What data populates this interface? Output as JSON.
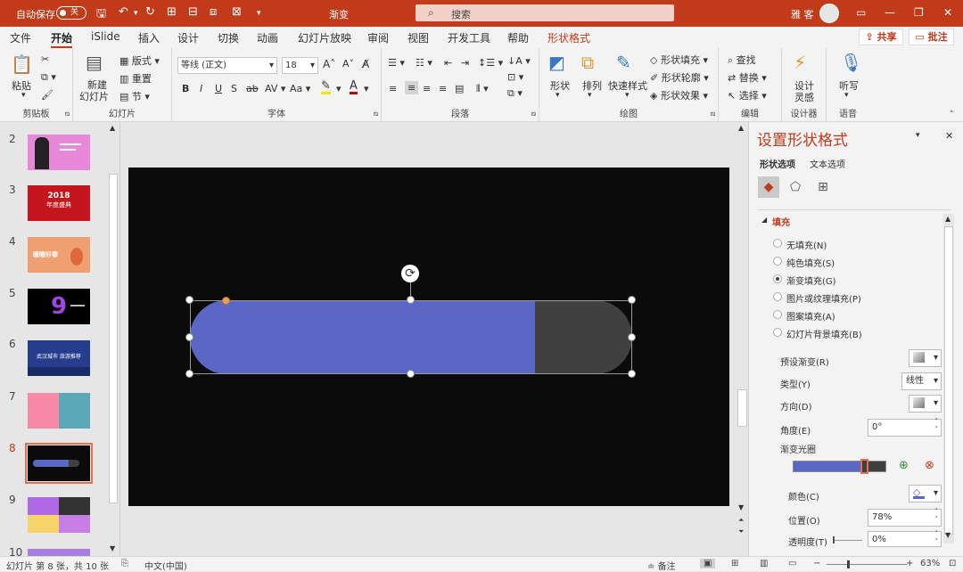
{
  "titlebar": {
    "autosave_label": "自动保存",
    "autosave_state": "关",
    "doc_title": "渐变",
    "search_label": "搜索",
    "user_name": "雅 客"
  },
  "tabs": [
    "文件",
    "开始",
    "iSlide",
    "插入",
    "设计",
    "切换",
    "动画",
    "幻灯片放映",
    "审阅",
    "视图",
    "开发工具",
    "帮助",
    "形状格式"
  ],
  "active_tab": "开始",
  "share_label": "共享",
  "comment_label": "批注",
  "ribbon": {
    "clipboard": {
      "paste": "粘贴",
      "label": "剪贴板"
    },
    "slides": {
      "new_slide_1": "新建",
      "new_slide_2": "幻灯片",
      "layout": "版式",
      "reset": "重置",
      "section": "节",
      "label": "幻灯片"
    },
    "font": {
      "name": "等线 (正文)",
      "size": "18",
      "label": "字体"
    },
    "paragraph": {
      "label": "段落"
    },
    "drawing": {
      "shapes": "形状",
      "arrange": "排列",
      "quick_styles": "快速样式",
      "shape_fill": "形状填充",
      "shape_outline": "形状轮廓",
      "shape_effects": "形状效果",
      "label": "绘图"
    },
    "editing": {
      "find": "查找",
      "replace": "替换",
      "select": "选择",
      "label": "编辑"
    },
    "designer": {
      "btn1": "设计",
      "btn2": "灵感",
      "label": "设计器"
    },
    "voice": {
      "btn": "听写",
      "label": "语音"
    }
  },
  "slide_numbers": [
    "2",
    "3",
    "4",
    "5",
    "6",
    "7",
    "8",
    "9",
    "10"
  ],
  "selected_slide": "8",
  "thumb_texts": {
    "t3": "2018",
    "t3b": "年度盛典",
    "t4": "暖暖好春",
    "t6": "武汉城市 旅游推荐"
  },
  "colors": {
    "accent": "#c13b1b",
    "bar_blue": "#5b67c4",
    "bar_gray": "#404040",
    "slide_bg": "#0b0b0b"
  },
  "pane": {
    "title": "设置形状格式",
    "tab_shape": "形状选项",
    "tab_text": "文本选项",
    "section": "填充",
    "fill_options": [
      "无填充(N)",
      "纯色填充(S)",
      "渐变填充(G)",
      "图片或纹理填充(P)",
      "图案填充(A)",
      "幻灯片背景填充(B)"
    ],
    "selected_fill": "渐变填充(G)",
    "preset_label": "预设渐变(R)",
    "type_label": "类型(Y)",
    "type_value": "线性",
    "direction_label": "方向(D)",
    "angle_label": "角度(E)",
    "angle_value": "0°",
    "stops_label": "渐变光圈",
    "color_label": "颜色(C)",
    "position_label": "位置(O)",
    "position_value": "78%",
    "transparency_label": "透明度(T)",
    "transparency_value": "0%"
  },
  "gradient_stop_position": 0.78,
  "status": {
    "slide_info": "幻灯片 第 8 张，共 10 张",
    "language": "中文(中国)",
    "notes": "备注",
    "zoom": "63%"
  }
}
